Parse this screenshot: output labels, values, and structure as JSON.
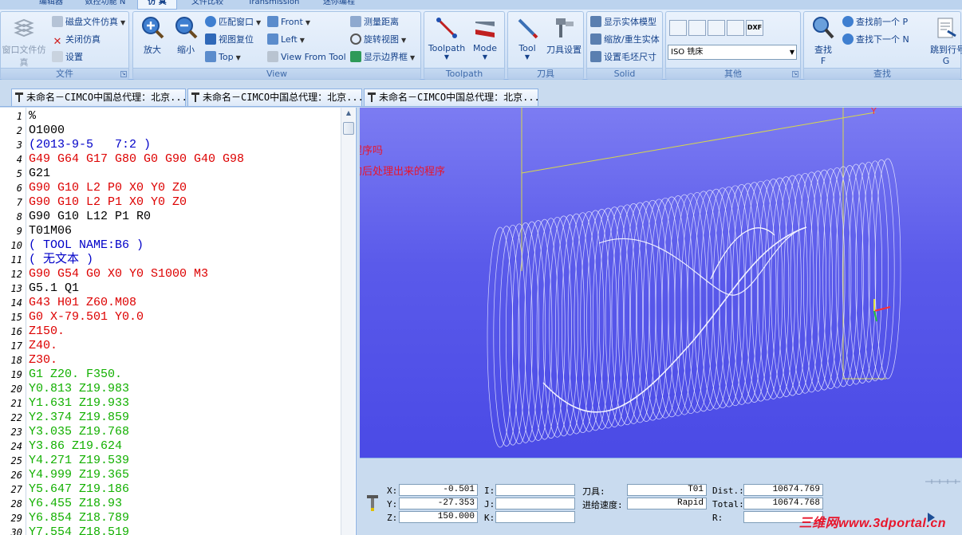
{
  "tabstrip": {
    "tabs": [
      {
        "label": "编辑器"
      },
      {
        "label": "数控功能 N"
      },
      {
        "label": "仿 真",
        "active": true
      },
      {
        "label": "文件比较"
      },
      {
        "label": "Transmission"
      },
      {
        "label": "迷你编程"
      }
    ]
  },
  "ribbon": {
    "file_group": {
      "title": "文件",
      "open_window_label": "窗口文件仿真",
      "disk_sim_label": "磁盘文件仿真",
      "close_sim_label": "关闭仿真",
      "settings_label": "设置"
    },
    "view_group": {
      "title": "View",
      "zoom_in_label": "放大",
      "zoom_out_label": "缩小",
      "fit_window_label": "匹配窗口",
      "reset_view_label": "视图复位",
      "top_label": "Top",
      "front_label": "Front",
      "left_label": "Left",
      "view_from_tool_label": "View From Tool",
      "measure_label": "测量距离",
      "rotate_label": "旋转视图",
      "show_border_label": "显示边界框"
    },
    "toolpath_group": {
      "title": "Toolpath",
      "toolpath_label": "Toolpath",
      "mode_label": "Mode"
    },
    "tool_group": {
      "title": "刀具",
      "tool_label": "Tool",
      "tool_settings_label": "刀具设置"
    },
    "solid_group": {
      "title": "Solid",
      "show_solid_label": "显示实体模型",
      "zoom_regen_label": "缩放/重生实体",
      "stock_size_label": "设置毛坯尺寸"
    },
    "other_group": {
      "title": "其他",
      "dxf_label": "DXF",
      "machine_select": "ISO 铣床"
    },
    "find_group": {
      "title": "查找",
      "find_label": "查找",
      "find_key": "F",
      "find_prev_label": "查找前一个 P",
      "find_next_label": "查找下一个 N",
      "goto_label": "跳到行号/字段",
      "goto_key": "G"
    }
  },
  "doc_tabs": [
    {
      "label": "未命名－CIMCO中国总代理：北京..."
    },
    {
      "label": "未命名－CIMCO中国总代理：北京..."
    },
    {
      "label": "未命名－CIMCO中国总代理：北京..."
    }
  ],
  "editor": {
    "lines": [
      {
        "n": "1",
        "text": "%",
        "color": "black"
      },
      {
        "n": "2",
        "text": "O1000",
        "color": "black"
      },
      {
        "n": "3",
        "text": "(2013-9-5   7:2 )",
        "color": "blue"
      },
      {
        "n": "4",
        "text": "G49 G64 G17 G80 G0 G90 G40 G98",
        "color": "red"
      },
      {
        "n": "5",
        "text": "G21",
        "color": "black"
      },
      {
        "n": "6",
        "text": "G90 G10 L2 P0 X0 Y0 Z0",
        "color": "red"
      },
      {
        "n": "7",
        "text": "G90 G10 L2 P1 X0 Y0 Z0",
        "color": "red"
      },
      {
        "n": "8",
        "text": "G90 G10 L12 P1 R0",
        "color": "black"
      },
      {
        "n": "9",
        "text": "T01M06",
        "color": "black"
      },
      {
        "n": "10",
        "text": "( TOOL NAME:B6 )",
        "color": "blue"
      },
      {
        "n": "11",
        "text": "( 无文本 )",
        "color": "blue"
      },
      {
        "n": "12",
        "text": "G90 G54 G0 X0 Y0 S1000 M3",
        "color": "red"
      },
      {
        "n": "13",
        "text": "G5.1 Q1",
        "color": "black"
      },
      {
        "n": "14",
        "text": "G43 H01 Z60.M08",
        "color": "red"
      },
      {
        "n": "15",
        "text": "G0 X-79.501 Y0.0",
        "color": "red"
      },
      {
        "n": "16",
        "text": "Z150.",
        "color": "red"
      },
      {
        "n": "17",
        "text": "Z40.",
        "color": "red"
      },
      {
        "n": "18",
        "text": "Z30.",
        "color": "red"
      },
      {
        "n": "19",
        "text": "G1 Z20. F350.",
        "color": "green"
      },
      {
        "n": "20",
        "text": "Y0.813 Z19.983",
        "color": "green"
      },
      {
        "n": "21",
        "text": "Y1.631 Z19.933",
        "color": "green"
      },
      {
        "n": "22",
        "text": "Y2.374 Z19.859",
        "color": "green"
      },
      {
        "n": "23",
        "text": "Y3.035 Z19.768",
        "color": "green"
      },
      {
        "n": "24",
        "text": "Y3.86 Z19.624",
        "color": "green"
      },
      {
        "n": "25",
        "text": "Y4.271 Z19.539",
        "color": "green"
      },
      {
        "n": "26",
        "text": "Y4.999 Z19.365",
        "color": "green"
      },
      {
        "n": "27",
        "text": "Y5.647 Z19.186",
        "color": "green"
      },
      {
        "n": "28",
        "text": "Y6.455 Z18.93",
        "color": "green"
      },
      {
        "n": "29",
        "text": "Y6.854 Z18.789",
        "color": "green"
      },
      {
        "n": "30",
        "text": "Y7.554 Z18.519",
        "color": "green"
      }
    ]
  },
  "viewport": {
    "annotation_1": "可以出三轴程序吗",
    "annotation_2": "这个是三轴的后处理出来的程序"
  },
  "status": {
    "x_label": "X:",
    "x_value": "-0.501",
    "y_label": "Y:",
    "y_value": "-27.353",
    "z_label": "Z:",
    "z_value": "150.000",
    "i_label": "I:",
    "i_value": "",
    "j_label": "J:",
    "j_value": "",
    "k_label": "K:",
    "k_value": "",
    "tool_label": "刀具:",
    "tool_value": "T01",
    "feed_label": "进给速度:",
    "feed_value": "Rapid",
    "dist_label": "Dist.:",
    "dist_value": "10674.769",
    "total_label": "Total:",
    "total_value": "10674.768",
    "r_label": "R:",
    "r_value": ""
  },
  "watermark": "三维网www.3dportal.cn",
  "colors": {
    "code_red": "#dd0000",
    "code_blue": "#0000c8",
    "code_green": "#12b000",
    "viewport_bg": "#5a5aea",
    "annotation": "#e8162c"
  }
}
